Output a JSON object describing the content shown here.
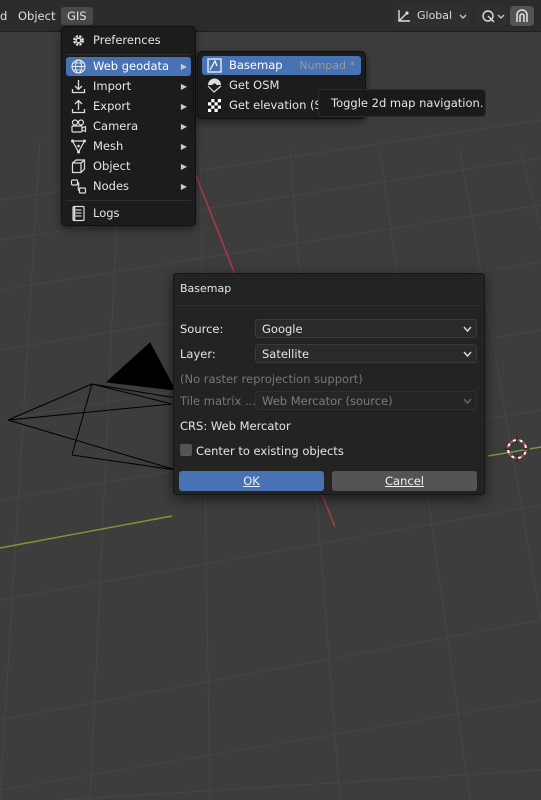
{
  "header": {
    "menus": [
      {
        "label": "d"
      },
      {
        "label": "Object"
      },
      {
        "label": "GIS"
      }
    ],
    "orientation_label": "Global",
    "icons": [
      "transform-orientation-icon",
      "chevron-down-icon",
      "link-icon",
      "snap-icon"
    ]
  },
  "gis_menu": {
    "items": [
      {
        "label": "Preferences",
        "icon": "gear-icon"
      },
      {
        "label": "Web geodata",
        "icon": "globe-icon",
        "submenu": true
      },
      {
        "label": "Import",
        "icon": "import-icon",
        "submenu": true
      },
      {
        "label": "Export",
        "icon": "export-icon",
        "submenu": true
      },
      {
        "label": "Camera",
        "icon": "camera-icon",
        "submenu": true
      },
      {
        "label": "Mesh",
        "icon": "mesh-icon",
        "submenu": true
      },
      {
        "label": "Object",
        "icon": "cube-icon",
        "submenu": true
      },
      {
        "label": "Nodes",
        "icon": "nodes-icon",
        "submenu": true
      },
      {
        "label": "Logs",
        "icon": "logs-icon"
      }
    ]
  },
  "web_geodata_menu": {
    "items": [
      {
        "label": "Basemap",
        "shortcut": "Numpad *",
        "icon": "basemap-icon"
      },
      {
        "label": "Get OSM",
        "icon": "osm-icon"
      },
      {
        "label": "Get elevation (SR",
        "icon": "elevation-icon"
      }
    ]
  },
  "tooltip": {
    "text": "Toggle 2d map navigation."
  },
  "dialog": {
    "title": "Basemap",
    "source_label": "Source:",
    "source_value": "Google",
    "layer_label": "Layer:",
    "layer_value": "Satellite",
    "note": "(No raster reprojection support)",
    "tile_matrix_label": "Tile matrix ...",
    "tile_matrix_value": "Web Mercator (source)",
    "crs_text": "CRS: Web Mercator",
    "center_label": "Center to existing objects",
    "center_checked": false,
    "ok_label": "OK",
    "cancel_label": "Cancel"
  },
  "colors": {
    "viewport_bg": "#3c3c3c",
    "highlight": "#4772b3",
    "x_axis": "#b33a44",
    "y_axis": "#7a9a33"
  }
}
